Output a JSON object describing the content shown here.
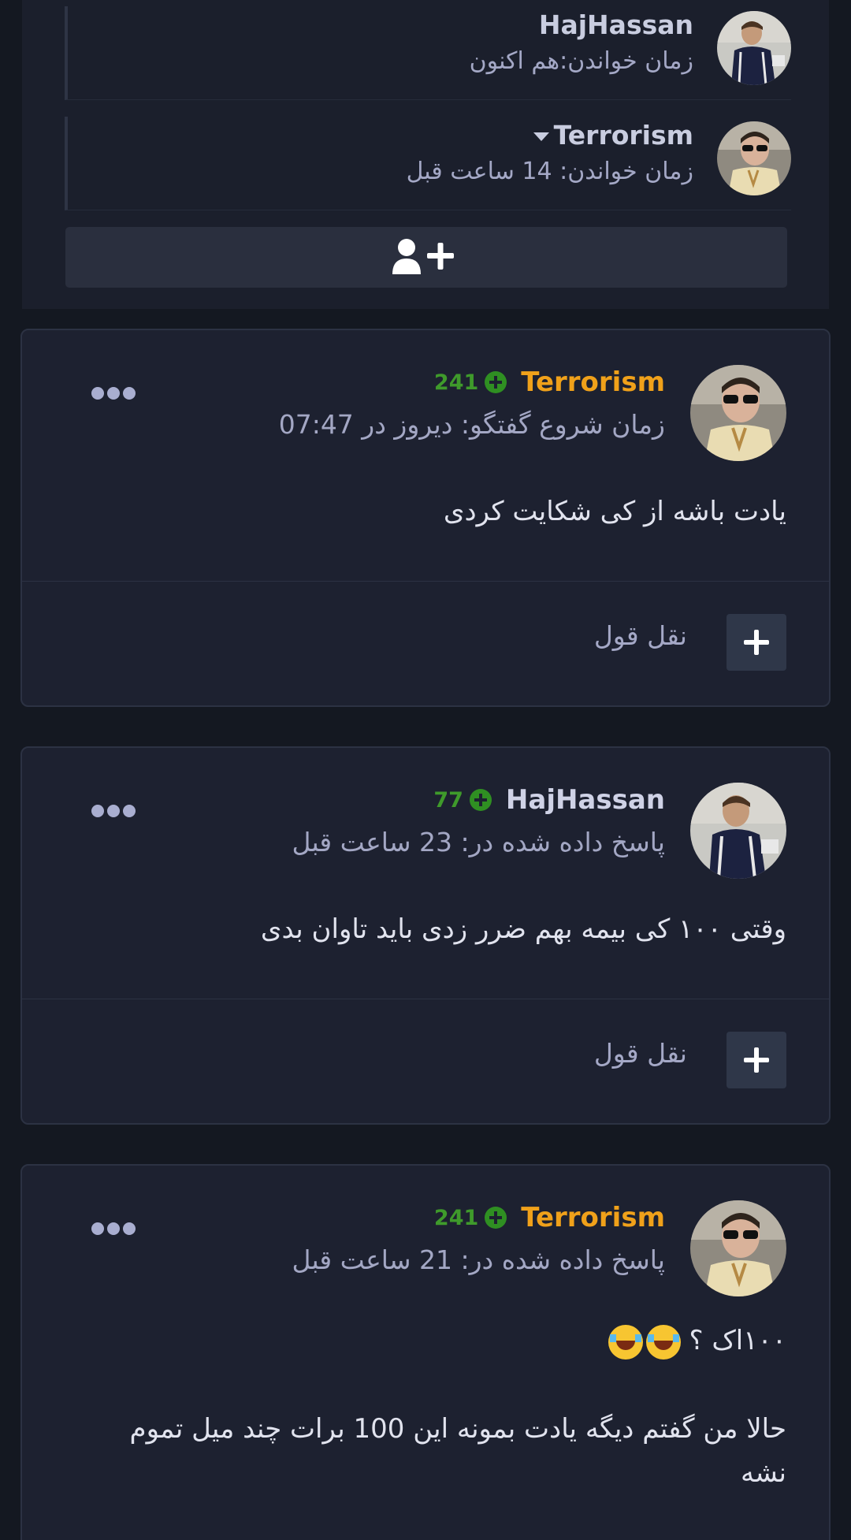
{
  "readers": [
    {
      "name": "HajHassan",
      "time": "زمان خواندن:هم اکنون",
      "has_caret": false
    },
    {
      "name": "Terrorism",
      "time": "زمان خواندن: 14 ساعت قبل",
      "has_caret": true
    }
  ],
  "add_reader_icon": "add-user-icon",
  "posts": [
    {
      "author": "Terrorism",
      "author_color": "#f0a11a",
      "reputation": "241",
      "date": "زمان شروع گفتگو: دیروز در 07:47",
      "body": [
        "یادت باشه از کی شکایت کردی"
      ],
      "quote_label": "نقل قول"
    },
    {
      "author": "HajHassan",
      "author_color": "#cfd2e6",
      "reputation": "77",
      "date": "پاسخ داده شده در: 23 ساعت قبل",
      "body": [
        "وقتی ۱۰۰ کی بیمه بهم ضرر زدی باید تاوان بدی"
      ],
      "quote_label": "نقل قول"
    },
    {
      "author": "Terrorism",
      "author_color": "#f0a11a",
      "reputation": "241",
      "date": "پاسخ داده شده در: 21 ساعت قبل",
      "body": [
        "۱۰۰اک ؟",
        "حالا من گفتم دیگه یادت بمونه این 100 برات چند میل تموم نشه"
      ],
      "emoji": "face-with-tears-of-joy-icon"
    }
  ]
}
